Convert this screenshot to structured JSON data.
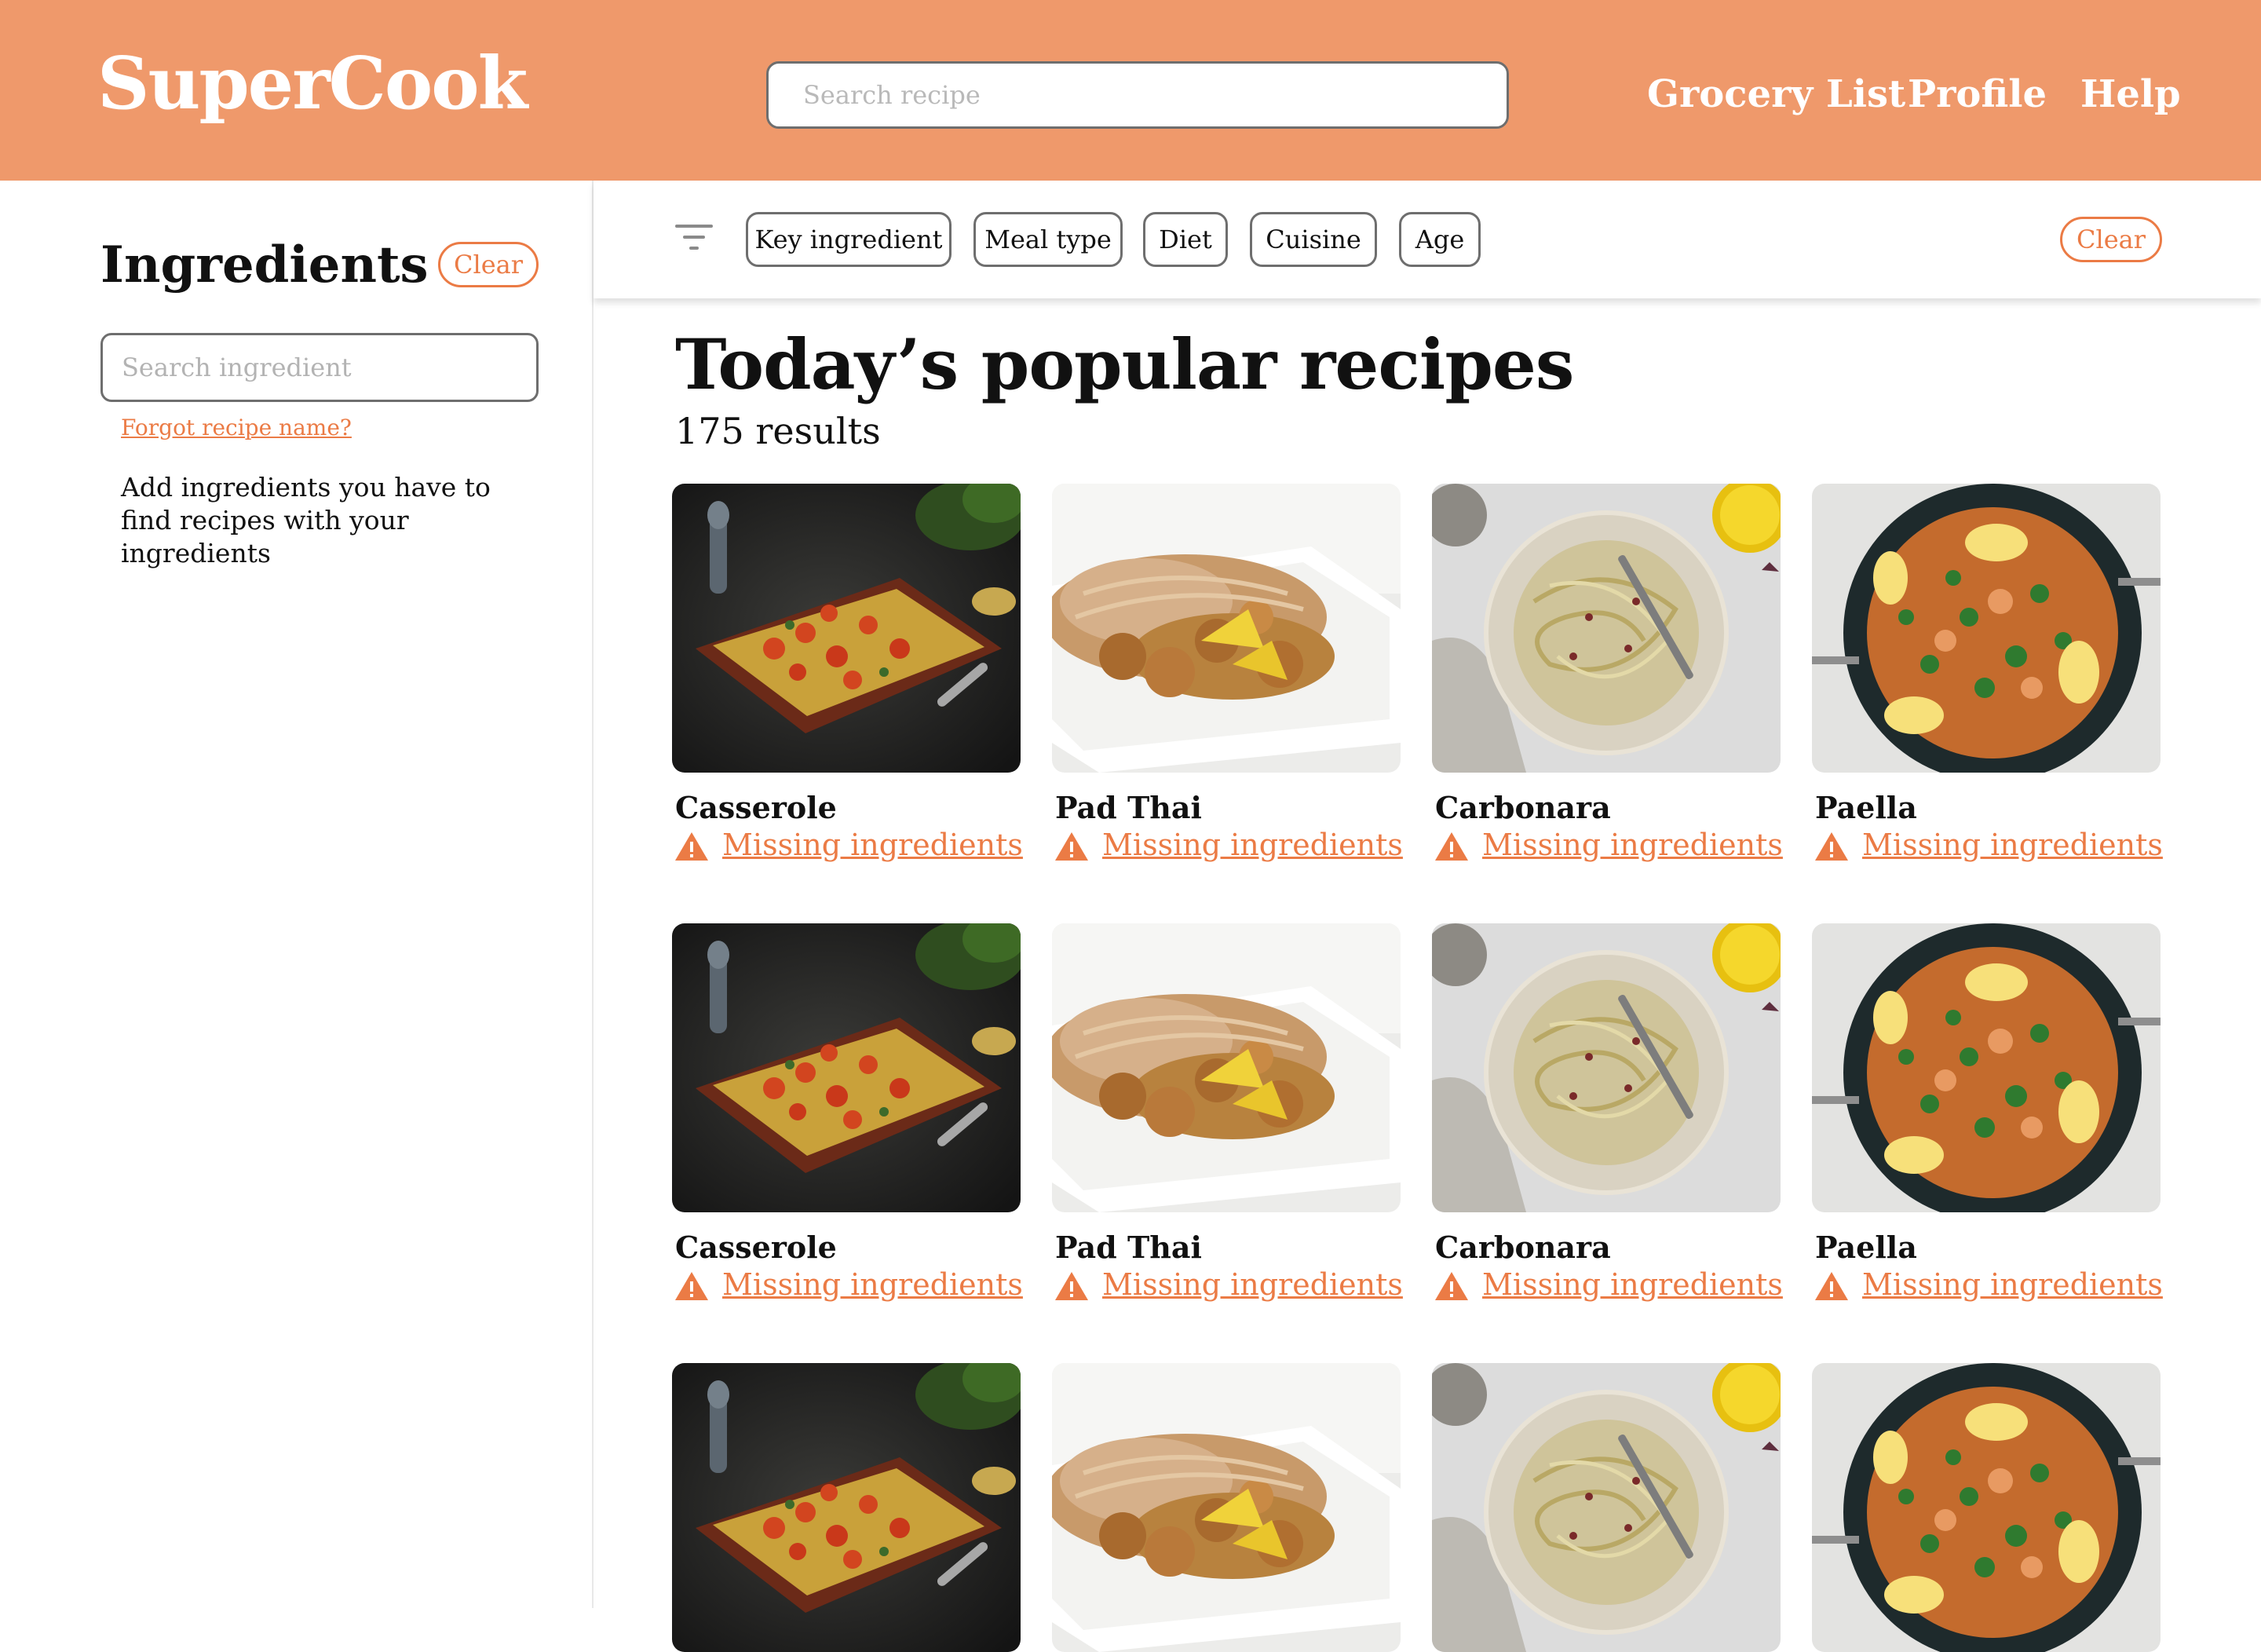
{
  "app": {
    "logo": "SuperCook",
    "search_placeholder": "Search recipe",
    "nav": [
      "Grocery List",
      "Profile",
      "Help"
    ],
    "accent_color": "#EF996B",
    "link_color": "#EB7B45"
  },
  "sidebar": {
    "title": "Ingredients",
    "clear_label": "Clear",
    "search_placeholder": "Search ingredient",
    "forgot_link": "Forgot recipe name?",
    "hint": "Add ingredients you have to find recipes with your ingredients"
  },
  "filters": {
    "icon": "filter-icon",
    "chips": [
      "Key ingredient",
      "Meal type",
      "Diet",
      "Cuisine",
      "Age"
    ],
    "clear_label": "Clear"
  },
  "main": {
    "title": "Today’s popular recipes",
    "results": "175 results",
    "missing_label": "Missing ingredients",
    "missing_icon": "warning-icon",
    "recipes": [
      {
        "name": "Casserole",
        "image": "casserole-image"
      },
      {
        "name": "Pad Thai",
        "image": "pad-thai-image"
      },
      {
        "name": "Carbonara",
        "image": "carbonara-image"
      },
      {
        "name": "Paella",
        "image": "paella-image"
      },
      {
        "name": "Casserole",
        "image": "casserole-image"
      },
      {
        "name": "Pad Thai",
        "image": "pad-thai-image"
      },
      {
        "name": "Carbonara",
        "image": "carbonara-image"
      },
      {
        "name": "Paella",
        "image": "paella-image"
      },
      {
        "name": "",
        "image": "casserole-image"
      },
      {
        "name": "",
        "image": "pad-thai-image"
      },
      {
        "name": "",
        "image": "carbonara-image"
      },
      {
        "name": "",
        "image": "paella-image"
      }
    ]
  }
}
